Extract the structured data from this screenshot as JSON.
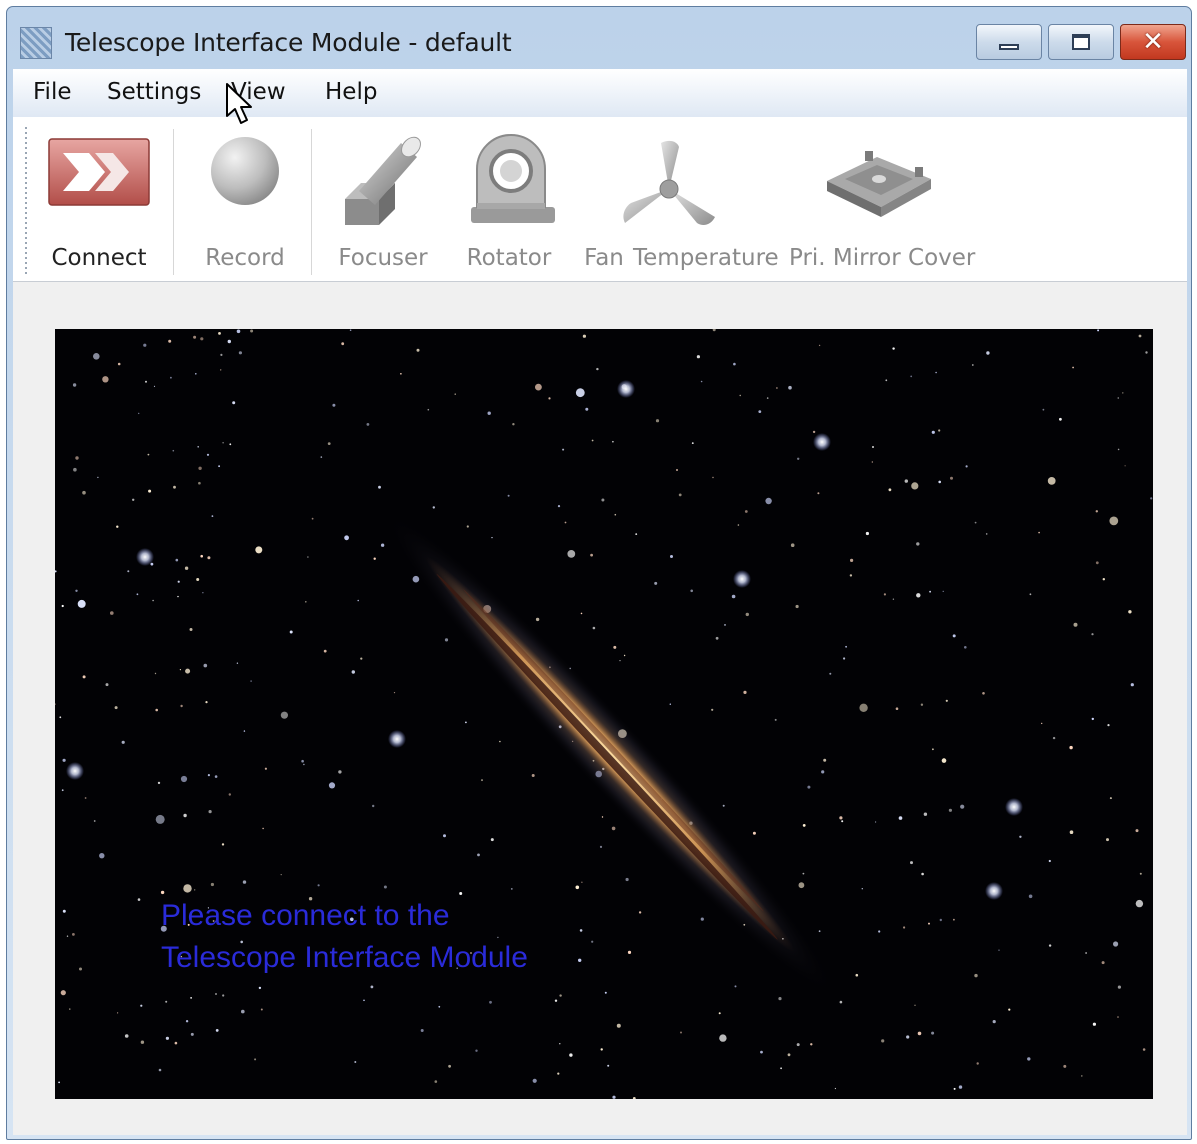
{
  "window": {
    "title": "Telescope Interface Module - default",
    "app_icon": "grid-app-icon",
    "controls": {
      "minimize": "minimize-icon",
      "maximize": "maximize-icon",
      "close": "close-icon"
    },
    "close_glyph": "✕"
  },
  "menu": {
    "file": "File",
    "settings": "Settings",
    "view": "View",
    "help": "Help"
  },
  "toolbar": {
    "connect": {
      "label": "Connect",
      "icon": "connect-chevron-icon",
      "enabled": true
    },
    "record": {
      "label": "Record",
      "icon": "record-sphere-icon",
      "enabled": false
    },
    "focuser": {
      "label": "Focuser",
      "icon": "focuser-tube-icon",
      "enabled": false
    },
    "rotator": {
      "label": "Rotator",
      "icon": "rotator-ring-icon",
      "enabled": false
    },
    "fan": {
      "label": "Fan",
      "icon": "fan-blade-icon",
      "enabled": false
    },
    "temperature": {
      "label": "Temperature",
      "enabled": false
    },
    "mirror_cover": {
      "label": "Pri. Mirror Cover",
      "icon": "mirror-cover-icon",
      "enabled": false
    }
  },
  "viewer": {
    "message_line1": "Please connect to the",
    "message_line2": "Telescope Interface Module",
    "message_color": "#2a2bd9"
  },
  "colors": {
    "connect_accent": "#c9615c",
    "title_bar": "#c6d8ed",
    "close_button": "#d24a30"
  }
}
